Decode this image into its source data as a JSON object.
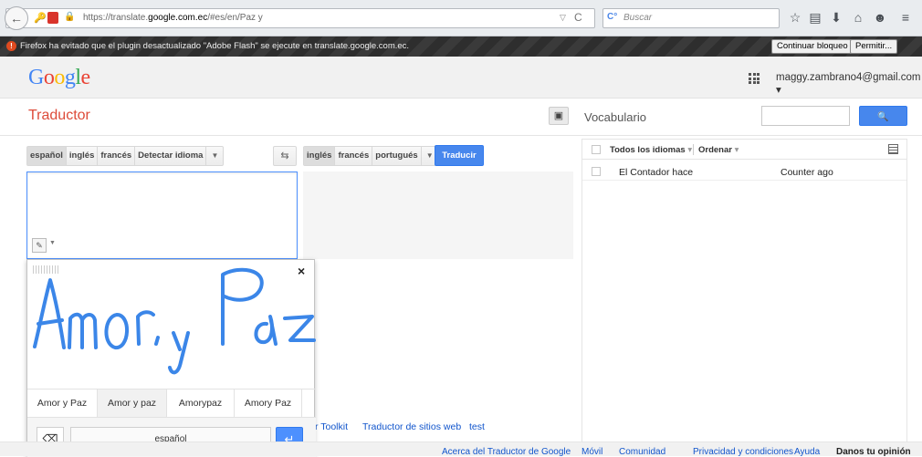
{
  "browser": {
    "url_prefix": "https://translate.",
    "url_host": "google.com.ec",
    "url_path": "/#es/en/Paz y",
    "search_placeholder": "Buscar",
    "reload_icon": "reload-icon",
    "dropdown_icon": "chevron-down-icon"
  },
  "flash_bar": {
    "message": "Firefox ha evitado que el plugin desactualizado \"Adobe Flash\" se ejecute en translate.google.com.ec.",
    "continue_label": "Continuar bloqueo",
    "allow_label": "Permitir..."
  },
  "header": {
    "logo": {
      "G": "G",
      "o1": "o",
      "o2": "o",
      "g": "g",
      "l": "l",
      "e": "e"
    },
    "account": "maggy.zambrano4@gmail.com ▾"
  },
  "translator": {
    "title": "Traductor",
    "source_langs": [
      "español",
      "inglés",
      "francés",
      "Detectar idioma"
    ],
    "target_langs": [
      "inglés",
      "francés",
      "portugués"
    ],
    "translate_button": "Traducir",
    "source_text": "",
    "result_text": ""
  },
  "handwriting": {
    "strokes_text": "Amor y Paz",
    "candidates": [
      "Amor y Paz",
      "Amor y paz",
      "Amorypaz",
      "Amory Paz"
    ],
    "selected_candidate": 1,
    "language": "español",
    "close": "×",
    "enter": "↵",
    "backspace": "⌫"
  },
  "bottom_links": [
    "r Toolkit",
    "Traductor de sitios web",
    "test"
  ],
  "vocabulary": {
    "title": "Vocabulario",
    "search_button": "🔍",
    "filter_language": "Todos los idiomas",
    "sort": "Ordenar",
    "rows": [
      {
        "source": "El Contador hace",
        "target": "Counter ago"
      }
    ]
  },
  "footer": {
    "links": [
      "Acerca del Traductor de Google",
      "Móvil",
      "Comunidad",
      "Privacidad y condiciones",
      "Ayuda",
      "Danos tu opinión"
    ]
  },
  "colors": {
    "accent_blue": "#4787ed",
    "title_red": "#dd4b39",
    "ink_blue": "#3b86e8"
  }
}
